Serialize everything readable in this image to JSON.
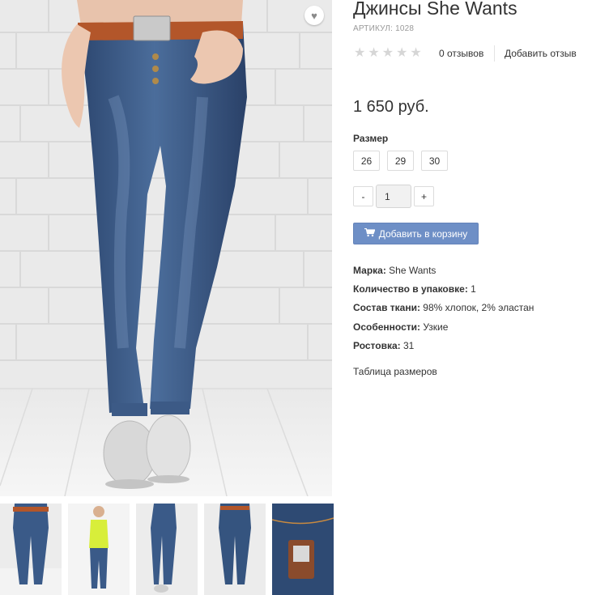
{
  "product": {
    "title": "Джинсы She Wants",
    "sku_label": "АРТИКУЛ:",
    "sku_value": "1028",
    "rating": 0,
    "rating_max": 5,
    "reviews_count": "0 отзывов",
    "add_review": "Добавить отзыв",
    "price": "1 650 руб."
  },
  "size": {
    "label": "Размер",
    "options": [
      "26",
      "29",
      "30"
    ]
  },
  "quantity": {
    "minus": "-",
    "value": "1",
    "plus": "+"
  },
  "cart": {
    "label": "Добавить в корзину",
    "icon": "cart-icon",
    "color": "#6e8fc6"
  },
  "properties": [
    {
      "label": "Марка:",
      "value": "She Wants"
    },
    {
      "label": "Количество в упаковке:",
      "value": "1"
    },
    {
      "label": "Состав ткани:",
      "value": "98% хлопок, 2% эластан"
    },
    {
      "label": "Особенности:",
      "value": "Узкие"
    },
    {
      "label": "Ростовка:",
      "value": "31"
    }
  ],
  "size_table_link": "Таблица размеров",
  "icons": {
    "wishlist": "heart-icon",
    "rating": "star-icon"
  }
}
